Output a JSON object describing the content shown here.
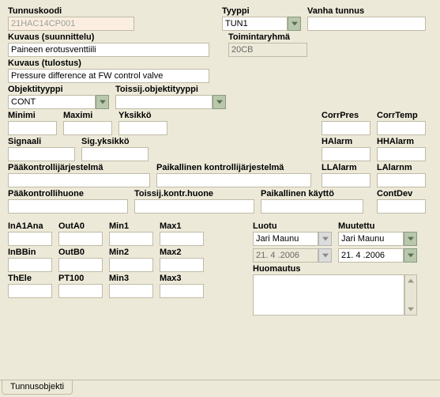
{
  "labels": {
    "tunnuskoodi": "Tunnuskoodi",
    "tyyppi": "Tyyppi",
    "vanhatunnus": "Vanha tunnus",
    "kuvaus_suunnittelu": "Kuvaus (suunnittelu)",
    "toimintaryhma": "Toimintaryhmä",
    "kuvaus_tulostus": "Kuvaus (tulostus)",
    "objektityyppi": "Objektityyppi",
    "toissij_obj": "Toissij.objektityyppi",
    "minimi": "Minimi",
    "maximi": "Maximi",
    "yksikko": "Yksikkö",
    "corrpres": "CorrPres",
    "corrtemp": "CorrTemp",
    "signaali": "Signaali",
    "sigyksikko": "Sig.yksikkö",
    "halarm": "HAlarm",
    "hhalarm": "HHAlarm",
    "paakontrollijarj": "Pääkontrollijärjestelmä",
    "paikkontrollijarj": "Paikallinen kontrollijärjestelmä",
    "llalarm": "LLAlarm",
    "lalarnm": "LAlarnm",
    "paakontrollihuone": "Pääkontrollihuone",
    "toissijkontrhuone": "Toissij.kontr.huone",
    "paikkaytto": "Paikallinen käyttö",
    "contdev": "ContDev",
    "ina1ana": "InA1Ana",
    "outa0": "OutA0",
    "min1": "Min1",
    "max1": "Max1",
    "inbbin": "InBBin",
    "outb0": "OutB0",
    "min2": "Min2",
    "max2": "Max2",
    "thele": "ThEle",
    "pt100": "PT100",
    "min3": "Min3",
    "max3": "Max3",
    "luotu": "Luotu",
    "muutettu": "Muutettu",
    "huomautus": "Huomautus"
  },
  "values": {
    "tunnuskoodi": "21HAC14CP001",
    "tyyppi": "TUN1",
    "vanhatunnus": "",
    "kuvaus_suunnittelu": "Paineen erotusventtiili",
    "toimintaryhma": "20CB",
    "kuvaus_tulostus": "Pressure difference at FW control valve",
    "objektityyppi": "CONT",
    "toissij_obj": "",
    "minimi": "",
    "maximi": "",
    "yksikko": "",
    "corrpres": "",
    "corrtemp": "",
    "signaali": "",
    "sigyksikko": "",
    "halarm": "",
    "hhalarm": "",
    "paakontrollijarj": "",
    "paikkontrollijarj": "",
    "llalarm": "",
    "lalarnm": "",
    "paakontrollihuone": "",
    "toissijkontrhuone": "",
    "paikkaytto": "",
    "contdev": "",
    "ina1ana": "",
    "outa0": "",
    "min1": "",
    "max1": "",
    "inbbin": "",
    "outb0": "",
    "min2": "",
    "max2": "",
    "thele": "",
    "pt100": "",
    "min3": "",
    "max3": "",
    "luotu_user": "Jari Maunu",
    "luotu_date": "21. 4 .2006",
    "muutettu_user": "Jari Maunu",
    "muutettu_date": "21. 4 .2006",
    "huomautus": ""
  },
  "tab": "Tunnusobjekti"
}
